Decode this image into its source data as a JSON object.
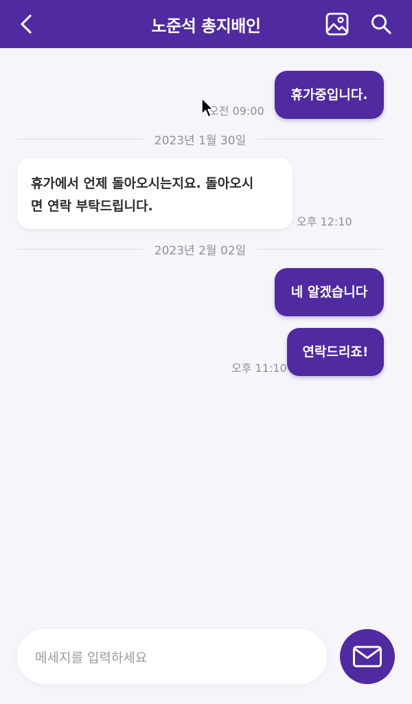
{
  "header": {
    "title": "노준석 총지배인",
    "back_icon": "chevron-left-icon",
    "image_icon": "image-icon",
    "search_icon": "search-icon"
  },
  "messages": [
    {
      "direction": "out",
      "text": "휴가중입니다.",
      "time": "오전 09:00"
    },
    {
      "divider_date": "2023년 1월 30일"
    },
    {
      "direction": "in",
      "line1": "휴가에서 언제 돌아오시는지요. 돌아오시",
      "line2": "면 연락 부탁드립니다.",
      "time": "오후 12:10"
    },
    {
      "divider_date": "2023년 2월 02일"
    },
    {
      "direction": "out",
      "text": "네 알겠습니다"
    },
    {
      "direction": "out",
      "text": "연락드리죠!",
      "time": "오후 11:10"
    }
  ],
  "composer": {
    "placeholder": "메세지를 입력하세요",
    "send_icon": "mail-icon"
  },
  "colors": {
    "brand": "#4f2aa0",
    "background": "#f6f5fa",
    "incoming_bubble": "#ffffff",
    "muted_text": "#8e8e96"
  }
}
